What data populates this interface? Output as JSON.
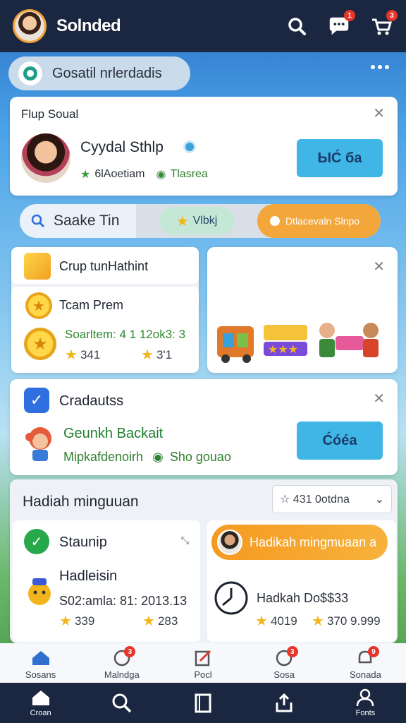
{
  "header": {
    "title": "Solnded",
    "messages_badge": "1",
    "cart_badge": "3"
  },
  "search_pill": {
    "text": "Gosatil nrlerdadis"
  },
  "profile_card": {
    "title": "Flup Soual",
    "name": "Cyydal Sthlp",
    "stat": "6lAoetiam",
    "location": "Tlasrea",
    "button_label": "ЫĆ ба"
  },
  "segments": {
    "search": "Saake Tin",
    "middle": "Vlbkj",
    "right": "Dtlacevaln Slnpo"
  },
  "groups_card": {
    "group_title": "Crup tunHathint",
    "team_title": "Tcam Prem",
    "stats_line": "Soarltem: 4 1 12ok3: 3",
    "stars_left": "341",
    "stars_right": "3'1"
  },
  "grad_card": {
    "title": "Cradautss",
    "name": "Geunkh Backait",
    "meta": "Mipkafdenoirh",
    "location": "Sho gouao",
    "button_label": "Ćóéa"
  },
  "weekly": {
    "title": "Hadiah minguuan",
    "select_value": "431 0otdna",
    "left": {
      "heading": "Staunip",
      "subtitle": "Hadleisin",
      "stats_line": "S02:amla: 81: 2013.13",
      "stars_left": "339",
      "stars_right": "283"
    },
    "right": {
      "pill_label": "Hadikah mingmuaan a",
      "subtitle": "Hadkah Do$$33",
      "stars_left": "4019",
      "stars_right": "370 9.999"
    }
  },
  "tabs": [
    {
      "label": "Sosans",
      "badge": ""
    },
    {
      "label": "Malndga",
      "badge": "3"
    },
    {
      "label": "Pocl",
      "badge": ""
    },
    {
      "label": "Sosa",
      "badge": "3"
    },
    {
      "label": "Sonada",
      "badge": "9"
    }
  ],
  "nav": [
    {
      "label": "Croan"
    },
    {
      "label": ""
    },
    {
      "label": ""
    },
    {
      "label": ""
    },
    {
      "label": "Fonts"
    }
  ],
  "colors": {
    "topbar": "#1b2740",
    "accent_blue": "#3fb6e6",
    "accent_orange": "#f3a63a",
    "badge_red": "#e8352c"
  }
}
